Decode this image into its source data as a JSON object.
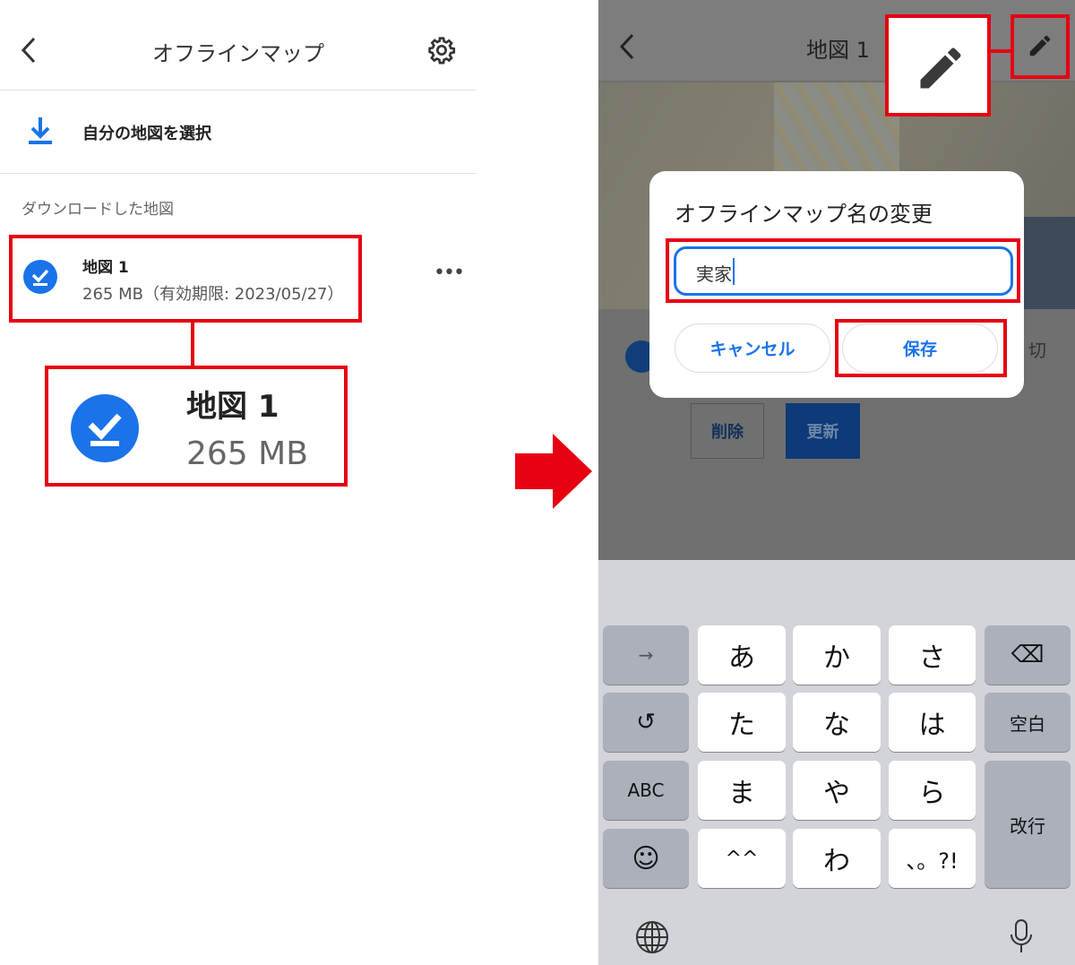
{
  "left": {
    "header": {
      "title": "オフラインマップ",
      "back_icon": "chevron-left-icon",
      "settings_icon": "gear-icon"
    },
    "select_own_map": {
      "label": "自分の地図を選択",
      "icon": "download-icon"
    },
    "section_label": "ダウンロードした地図",
    "map_item": {
      "title": "地図 1",
      "subtitle": "265 MB（有効期限: 2023/05/27）",
      "icon": "check-download-icon",
      "more_icon": "more-horizontal-icon"
    },
    "zoom_callout": {
      "title": "地図 1",
      "size": "265 MB"
    }
  },
  "arrow": {
    "color": "#e60012",
    "icon": "arrow-right-icon"
  },
  "right": {
    "header": {
      "title": "地図 1",
      "back_icon": "chevron-left-icon",
      "edit_icon": "pencil-icon"
    },
    "background": {
      "delete_label": "削除",
      "update_label": "更新",
      "partial_text": "切"
    },
    "dialog": {
      "title": "オフラインマップ名の変更",
      "input_value": "実家",
      "cancel_label": "キャンセル",
      "save_label": "保存"
    },
    "keyboard": {
      "rows": [
        [
          "→",
          "あ",
          "か",
          "さ",
          "⌫"
        ],
        [
          "↺",
          "た",
          "な",
          "は",
          "空白"
        ],
        [
          "ABC",
          "ま",
          "や",
          "ら",
          "改行"
        ],
        [
          "☺",
          "^^",
          "わ",
          "、。?!"
        ]
      ],
      "globe_icon": "globe-icon",
      "mic_icon": "microphone-icon"
    }
  },
  "colors": {
    "highlight": "#e60012",
    "accent": "#1a73e8"
  }
}
